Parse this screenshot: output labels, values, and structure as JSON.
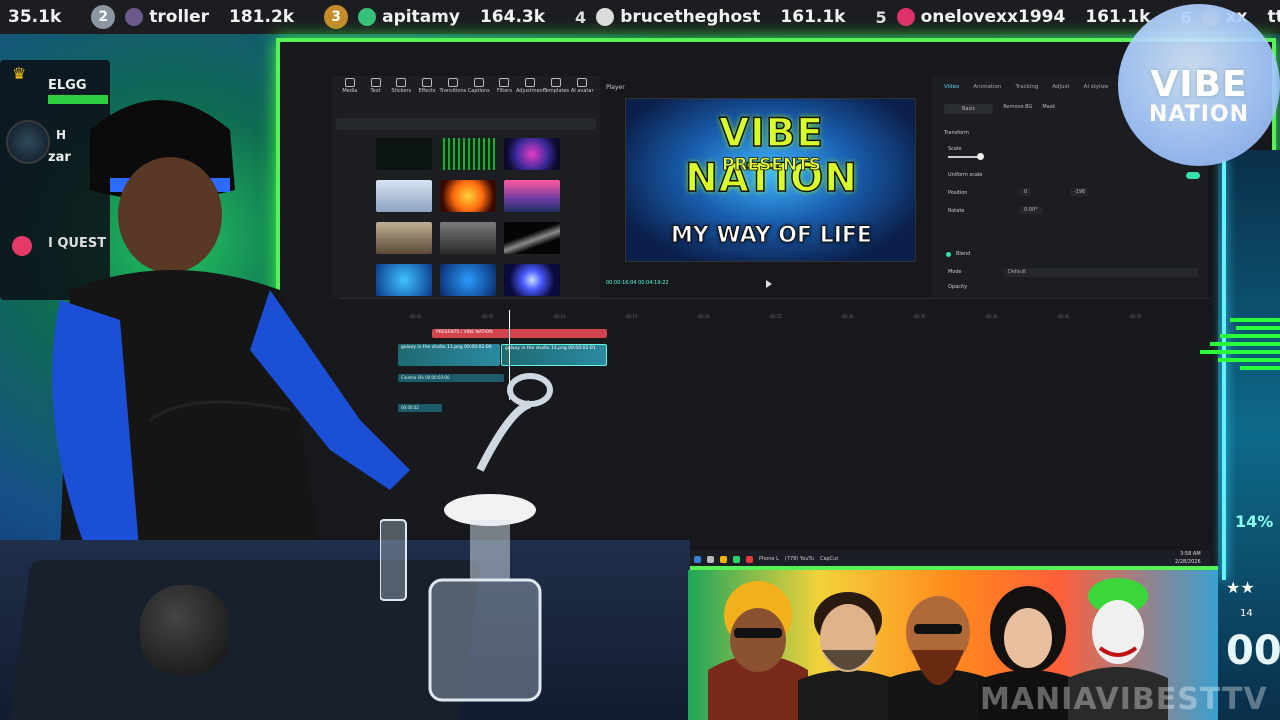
{
  "leaderboard": {
    "entries": [
      {
        "rank": "",
        "name": "",
        "score": "35.1k"
      },
      {
        "rank": "2",
        "name": "troller",
        "score": "181.2k"
      },
      {
        "rank": "3",
        "name": "apitamy",
        "score": "164.3k"
      },
      {
        "rank": "4",
        "name": "brucetheghost",
        "score": "161.1k"
      },
      {
        "rank": "5",
        "name": "onelovexx1994",
        "score": "161.1k"
      },
      {
        "rank": "6",
        "name": "xx",
        "score": "ttv"
      }
    ]
  },
  "left_hud": {
    "elgg_label": "ELGG",
    "hp_label": "H",
    "zar_label": "zar",
    "quest_label": "I QUEST"
  },
  "editor": {
    "toolbar": [
      "Media",
      "Text",
      "Stickers",
      "Effects",
      "Transitions",
      "Captions",
      "Filters",
      "Adjustment",
      "Templates",
      "AI avatar"
    ],
    "player_label": "Player",
    "preview": {
      "title": "VIBE NATION",
      "presents": "PRESENTS",
      "subtitle": "MY WAY OF LIFE",
      "timecode": "00:00:16:04  00:04:19:22"
    },
    "props": {
      "tabs": [
        "Video",
        "Animation",
        "Tracking",
        "Adjust",
        "AI stylize"
      ],
      "subtabs": [
        "Basic",
        "Remove BG",
        "Mask"
      ],
      "transform_label": "Transform",
      "scale_label": "Scale",
      "uniform_scale_label": "Uniform scale",
      "position_label": "Position",
      "position_x": "0",
      "position_y": "-196",
      "rotate_label": "Rotate",
      "rotate_val": "0.00°",
      "blend_label": "Blend",
      "mode_label": "Mode",
      "mode_value": "Default",
      "opacity_label": "Opacity"
    },
    "timeline": {
      "title_track": "PRESENTS / VIBE NATION",
      "clip_1": "galaxy in the studio 11.png  00:00:02:00",
      "clip_2": "galaxy in the studio 14.png  00:00:02:01",
      "sub_clip_1": "Cinema Sfx  00:00:03:00",
      "sub_clip_2": "00:00:02",
      "ruler": [
        "00:00",
        "00:05",
        "00:10",
        "00:15",
        "00:20",
        "00:25",
        "00:30",
        "00:35",
        "00:40",
        "00:45",
        "00:50"
      ]
    },
    "taskbar": {
      "items": [
        "Phone L",
        "(778) YouTu",
        "CapCut"
      ],
      "time": "3:58 AM",
      "date": "2/28/2026"
    }
  },
  "logo": {
    "line1": "VIBE",
    "line2": "NATION"
  },
  "right_panel": {
    "pct": "14%",
    "num": "14",
    "big": "00"
  },
  "banner": {
    "watermark": "MANIAVIBESTTV"
  },
  "colors": {
    "accent_green": "#57f257",
    "neon_cyan": "#67f0ff",
    "title_yellow": "#d9ff2a"
  }
}
